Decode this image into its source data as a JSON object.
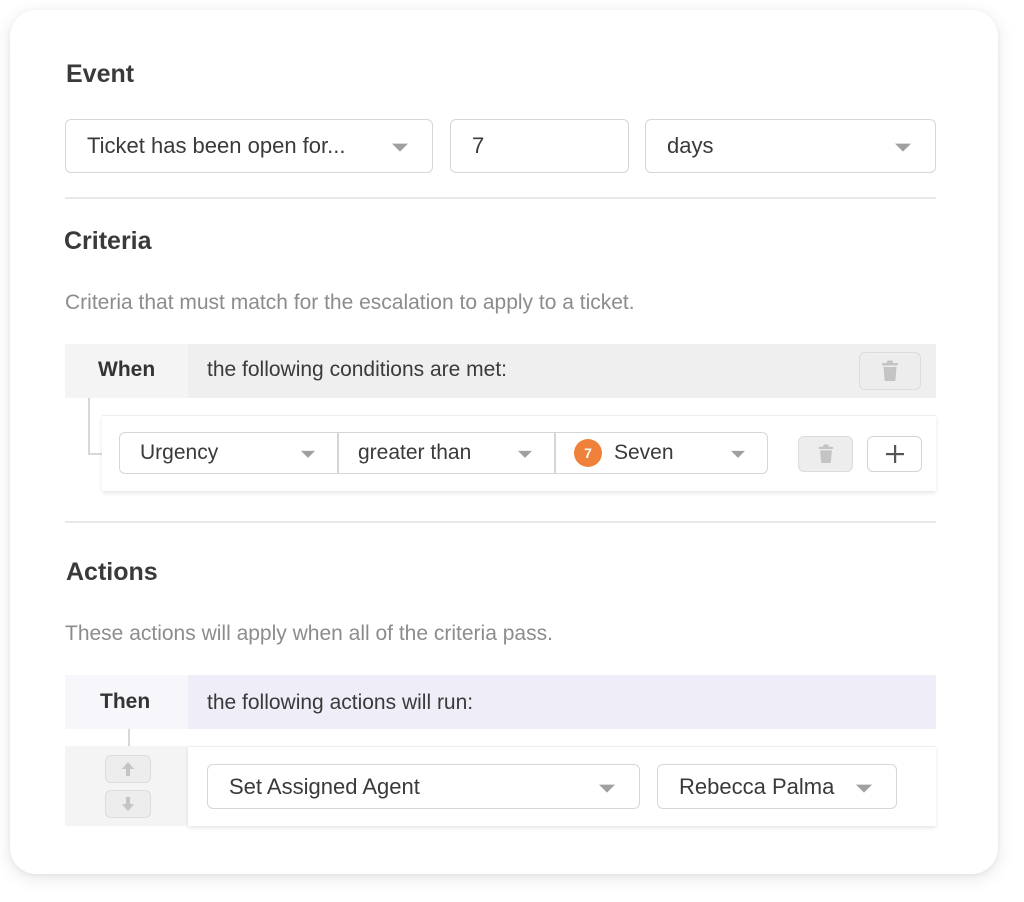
{
  "event": {
    "title": "Event",
    "trigger_select": "Ticket has been open for...",
    "amount_input": "7",
    "unit_select": "days"
  },
  "criteria": {
    "title": "Criteria",
    "description": "Criteria that must match for the escalation to apply to a ticket.",
    "when_label": "When",
    "when_text": "the following conditions are met:",
    "condition": {
      "field": "Urgency",
      "operator": "greater than",
      "value_badge": "7",
      "value": "Seven"
    }
  },
  "actions": {
    "title": "Actions",
    "description": "These actions will apply when all of the criteria pass.",
    "then_label": "Then",
    "then_text": "the following actions will run:",
    "action": {
      "type": "Set Assigned Agent",
      "agent": "Rebecca Palma"
    }
  },
  "colors": {
    "badge": "#f0813a",
    "when_bar": "#efefef",
    "then_bar": "#efedf8"
  }
}
